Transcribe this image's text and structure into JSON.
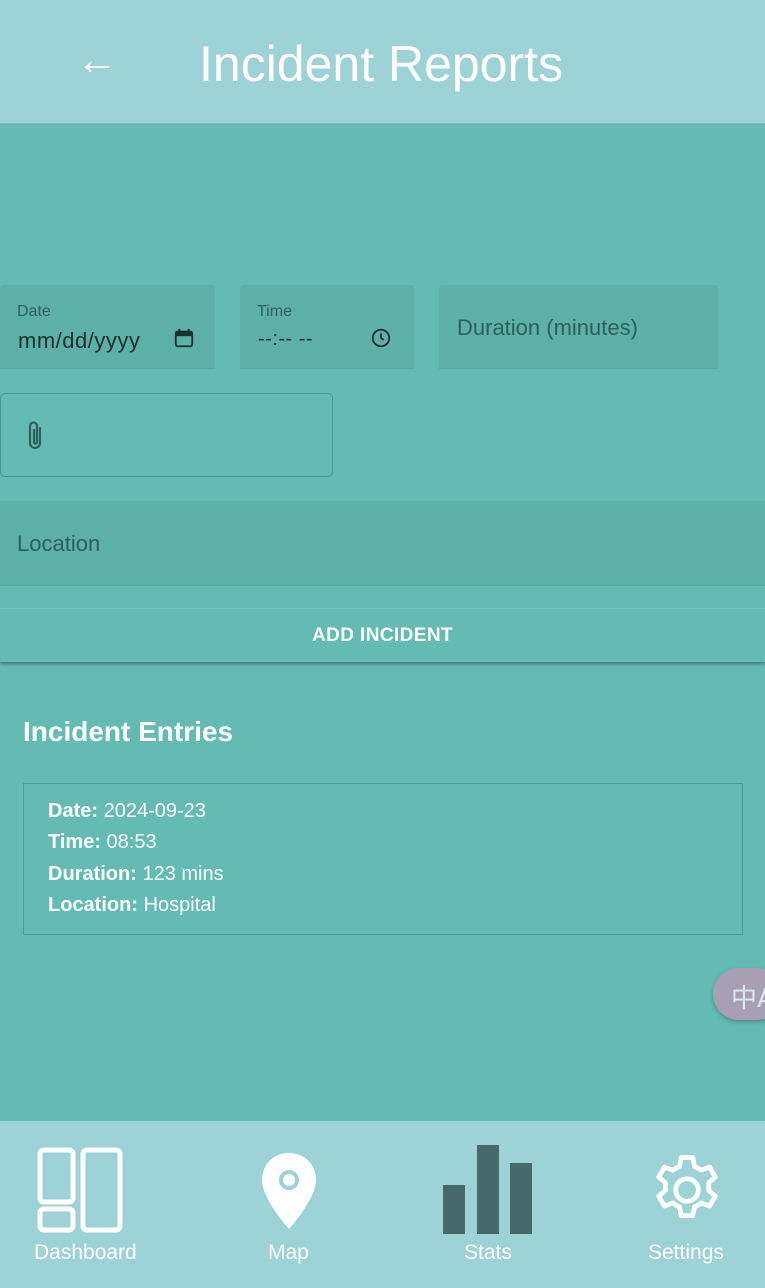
{
  "header": {
    "back_glyph": "←",
    "title": "Incident Reports"
  },
  "form": {
    "date": {
      "label": "Date",
      "value": "mm/dd/yyyy",
      "icon": "calendar-icon"
    },
    "time": {
      "label": "Time",
      "value": "--:-- --",
      "icon": "clock-icon"
    },
    "duration": {
      "placeholder": "Duration (minutes)"
    },
    "attachment": {
      "icon": "paperclip-icon"
    },
    "location": {
      "placeholder": "Location"
    },
    "add_button_label": "ADD INCIDENT"
  },
  "entries": {
    "title": "Incident Entries",
    "items": [
      {
        "date_label": "Date:",
        "date": "2024-09-23",
        "time_label": "Time:",
        "time": "08:53",
        "duration_label": "Duration:",
        "duration": "123 mins",
        "location_label": "Location:",
        "location": "Hospital"
      }
    ]
  },
  "translate": {
    "glyph": "中A",
    "icon": "translate-icon"
  },
  "nav": {
    "items": [
      {
        "label": "Dashboard",
        "icon": "dashboard-icon"
      },
      {
        "label": "Map",
        "icon": "map-pin-icon"
      },
      {
        "label": "Stats",
        "icon": "bar-chart-icon"
      },
      {
        "label": "Settings",
        "icon": "gear-icon"
      }
    ]
  },
  "colors": {
    "background": "#63bbb4",
    "header": "#9dd2d6",
    "field": "#5cb0a8",
    "stats_icon_active": "#456a69"
  }
}
